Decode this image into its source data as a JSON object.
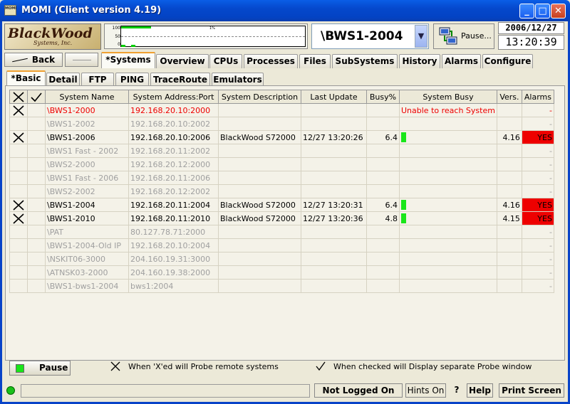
{
  "window": {
    "title": "MOMI (Client version 4.19)",
    "app_icon_text": "MOMI"
  },
  "logo": {
    "line1": "BlackWood",
    "line2": "Systems, Inc."
  },
  "graph": {
    "ticks": [
      "100",
      "50",
      "0"
    ],
    "percent_label": "1%",
    "busy_percent": 1
  },
  "system_selector": {
    "value": "\\BWS1-2004"
  },
  "pause_top": {
    "label": "Pause..."
  },
  "datetime": {
    "date": "2006/12/27",
    "time": "13:20:39"
  },
  "nav": {
    "back": "Back"
  },
  "main_tabs": [
    "*Systems",
    "Overview",
    "CPUs",
    "Processes",
    "Files",
    "SubSystems",
    "History",
    "Alarms",
    "Configure"
  ],
  "sub_tabs": [
    "*Basic",
    "Detail",
    "FTP",
    "PING",
    "TraceRoute",
    "Emulators"
  ],
  "table": {
    "columns": [
      "System Name",
      "System Address:Port",
      "System Description",
      "Last Update",
      "Busy%",
      "System Busy",
      "Vers.",
      "Alarms"
    ],
    "rows": [
      {
        "x": true,
        "check": false,
        "state": "err",
        "name": "\\BWS1-2000",
        "addr": "192.168.20.10:2000",
        "desc": "",
        "update": "",
        "busy": "",
        "busy_text": "Unable to reach System",
        "bar": false,
        "vers": "",
        "alarms": "-"
      },
      {
        "x": false,
        "check": false,
        "state": "off",
        "name": "\\BWS1-2002",
        "addr": "192.168.20.10:2002",
        "desc": "",
        "update": "",
        "busy": "",
        "busy_text": "",
        "bar": false,
        "vers": "",
        "alarms": "-"
      },
      {
        "x": true,
        "check": false,
        "state": "on",
        "name": "\\BWS1-2006",
        "addr": "192.168.20.10:2006",
        "desc": "BlackWood S72000",
        "update": "12/27 13:20:26",
        "busy": "6.4",
        "busy_text": "",
        "bar": true,
        "vers": "4.16",
        "alarms": "YES"
      },
      {
        "x": false,
        "check": false,
        "state": "off",
        "name": "\\BWS1 Fast - 2002",
        "addr": "192.168.20.11:2002",
        "desc": "",
        "update": "",
        "busy": "",
        "busy_text": "",
        "bar": false,
        "vers": "",
        "alarms": "-"
      },
      {
        "x": false,
        "check": false,
        "state": "off",
        "name": "\\BWS2-2000",
        "addr": "192.168.20.12:2000",
        "desc": "",
        "update": "",
        "busy": "",
        "busy_text": "",
        "bar": false,
        "vers": "",
        "alarms": "-"
      },
      {
        "x": false,
        "check": false,
        "state": "off",
        "name": "\\BWS1 Fast - 2006",
        "addr": "192.168.20.11:2006",
        "desc": "",
        "update": "",
        "busy": "",
        "busy_text": "",
        "bar": false,
        "vers": "",
        "alarms": "-"
      },
      {
        "x": false,
        "check": false,
        "state": "off",
        "name": "\\BWS2-2002",
        "addr": "192.168.20.12:2002",
        "desc": "",
        "update": "",
        "busy": "",
        "busy_text": "",
        "bar": false,
        "vers": "",
        "alarms": "-"
      },
      {
        "x": true,
        "check": false,
        "state": "on",
        "name": "\\BWS1-2004",
        "addr": "192.168.20.11:2004",
        "desc": "BlackWood S72000",
        "update": "12/27 13:20:31",
        "busy": "6.4",
        "busy_text": "",
        "bar": true,
        "vers": "4.16",
        "alarms": "YES"
      },
      {
        "x": true,
        "check": false,
        "state": "on",
        "name": "\\BWS1-2010",
        "addr": "192.168.20.11:2010",
        "desc": "BlackWood S72000",
        "update": "12/27 13:20:36",
        "busy": "4.8",
        "busy_text": "",
        "bar": true,
        "vers": "4.15",
        "alarms": "YES"
      },
      {
        "x": false,
        "check": false,
        "state": "off",
        "name": "\\PAT",
        "addr": "80.127.78.71:2000",
        "desc": "",
        "update": "",
        "busy": "",
        "busy_text": "",
        "bar": false,
        "vers": "",
        "alarms": "-"
      },
      {
        "x": false,
        "check": false,
        "state": "off",
        "name": "\\BWS1-2004-Old IP",
        "addr": "192.168.20.10:2004",
        "desc": "",
        "update": "",
        "busy": "",
        "busy_text": "",
        "bar": false,
        "vers": "",
        "alarms": "-"
      },
      {
        "x": false,
        "check": false,
        "state": "off",
        "name": "\\NSKIT06-3000",
        "addr": "204.160.19.31:3000",
        "desc": "",
        "update": "",
        "busy": "",
        "busy_text": "",
        "bar": false,
        "vers": "",
        "alarms": "-"
      },
      {
        "x": false,
        "check": false,
        "state": "off",
        "name": "\\ATNSK03-2000",
        "addr": "204.160.19.38:2000",
        "desc": "",
        "update": "",
        "busy": "",
        "busy_text": "",
        "bar": false,
        "vers": "",
        "alarms": "-"
      },
      {
        "x": false,
        "check": false,
        "state": "off",
        "name": "\\BWS1-bws1-2004",
        "addr": "bws1:2004",
        "desc": "",
        "update": "",
        "busy": "",
        "busy_text": "",
        "bar": false,
        "vers": "",
        "alarms": "-"
      }
    ]
  },
  "footer": {
    "pause_label": "Pause",
    "legend_x": "When 'X'ed will Probe remote systems",
    "legend_check": "When checked will Display separate Probe window"
  },
  "statusbar": {
    "login": "Not Logged On",
    "hints": "Hints On",
    "help_q": "?",
    "help": "Help",
    "print": "Print Screen"
  },
  "colors": {
    "titlebar": "#0548cc",
    "alarm": "#ee0000",
    "busy_bar": "#19e619",
    "error_text": "#e00000"
  }
}
